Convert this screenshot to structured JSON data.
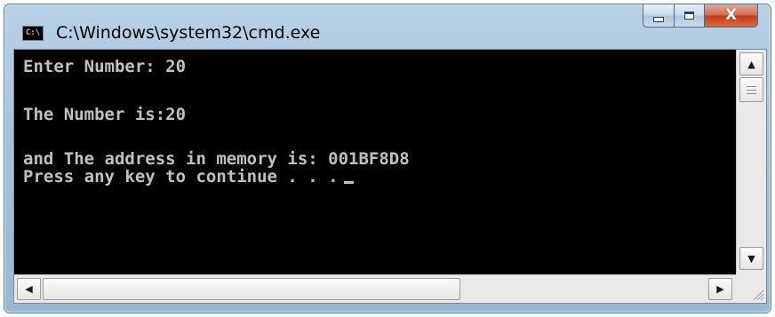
{
  "window": {
    "title": "C:\\Windows\\system32\\cmd.exe",
    "icon_text": "C:\\",
    "icon": "cmd-icon"
  },
  "caption_buttons": {
    "minimize": "minimize-icon",
    "maximize": "maximize-icon",
    "close": "close-icon",
    "close_glyph": "X"
  },
  "console": {
    "lines": [
      "Enter Number: 20",
      "The Number is:20",
      "and The address in memory is: 001BF8D8",
      "Press any key to continue . . ."
    ],
    "colors": {
      "background": "#000000",
      "text": "#c0c0c0"
    }
  },
  "scrollbars": {
    "up_arrow": "▲",
    "down_arrow": "▼",
    "left_arrow": "◀",
    "right_arrow": "▶"
  }
}
